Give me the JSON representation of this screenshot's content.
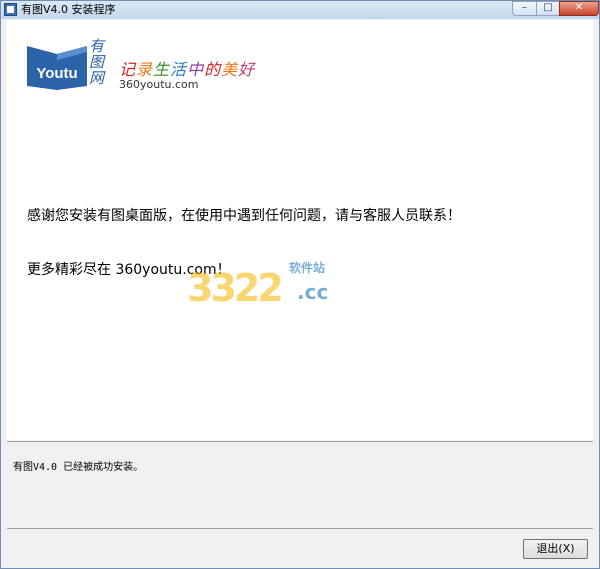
{
  "window": {
    "title": "有图V4.0 安装程序",
    "controls": {
      "minimize": "–",
      "maximize": "□",
      "close": "✕"
    }
  },
  "logo": {
    "brand_en": "Youtu",
    "brand_cn": "有图网",
    "slogan_chars": [
      "记",
      "录",
      "生",
      "活",
      "中",
      "的",
      "美",
      "好"
    ],
    "slogan_colors": [
      "#d2232a",
      "#e77a1a",
      "#3a8f2e",
      "#1f7ac0",
      "#8b3fa5",
      "#d2232a",
      "#e77a1a",
      "#c1386e"
    ],
    "domain": "360youtu.com",
    "brand_color": "#2b63a8"
  },
  "main": {
    "thanks_text": "感谢您安装有图桌面版，在使用中遇到任何问题，请与客服人员联系！",
    "more_text": "更多精彩尽在 360youtu.com！"
  },
  "watermark": {
    "number": "3322",
    "label": "软件站",
    "suffix": ".cc"
  },
  "status": {
    "text": "有图V4.0 已经被成功安装。"
  },
  "buttons": {
    "exit_label": "退出(X)"
  }
}
